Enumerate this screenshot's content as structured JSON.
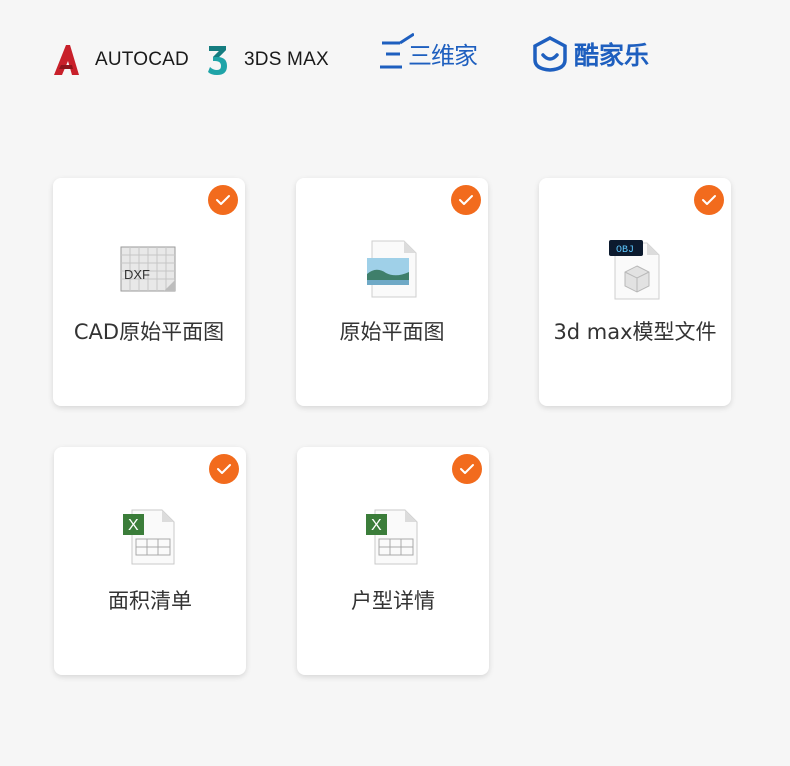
{
  "logos": {
    "autocad": "AUTOCAD",
    "max3ds": "3DS MAX",
    "sanweijia": "三维家",
    "kujiale": "酷家乐"
  },
  "colors": {
    "accent": "#f26b1d",
    "brand_blue": "#1e5fbf",
    "autocad_red": "#c8202a",
    "max_teal": "#1fa4a8",
    "excel_green": "#3b7d3a"
  },
  "cards": [
    {
      "label": "CAD原始平面图",
      "icon": "dxf-file-icon",
      "checked": true
    },
    {
      "label": "原始平面图",
      "icon": "image-file-icon",
      "checked": true
    },
    {
      "label": "3d max模型文件",
      "icon": "obj-file-icon",
      "checked": true
    },
    {
      "label": "面积清单",
      "icon": "excel-file-icon",
      "checked": true
    },
    {
      "label": "户型详情",
      "icon": "excel-file-icon",
      "checked": true
    }
  ],
  "icons": {
    "dxf_tag": "DXF",
    "obj_tag": "OBJ",
    "excel_tag": "X"
  }
}
